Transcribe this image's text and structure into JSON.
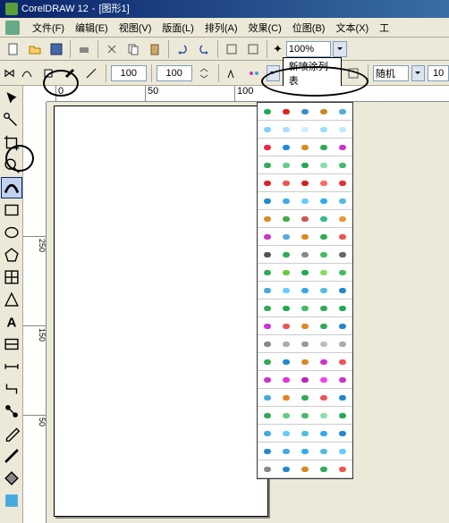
{
  "titlebar": {
    "appname": "CorelDRAW 12",
    "docname": "[图形1]"
  },
  "menu": {
    "file": "文件(F)",
    "edit": "编辑(E)",
    "view": "视图(V)",
    "layout": "版面(L)",
    "arrange": "排列(A)",
    "effects": "效果(C)",
    "bitmap": "位图(B)",
    "text": "文本(X)",
    "tools": "工"
  },
  "toolbar1": {
    "zoom": "100%"
  },
  "proptbar": {
    "size1": "100",
    "size2": "100",
    "spraylist_label": "新喷涂列表",
    "random": "随机",
    "val10": "10"
  },
  "ruler_h": {
    "t0": "0",
    "t50": "50",
    "t100": "100"
  },
  "ruler_v": {
    "t50": "50",
    "t150": "150",
    "t250": "250"
  },
  "spray_colors": [
    [
      "#2a5",
      "#d22",
      "#48c",
      "#c82",
      "#5ad"
    ],
    [
      "#8cf",
      "#adf",
      "#cef",
      "#9df",
      "#bef"
    ],
    [
      "#e24",
      "#28d",
      "#d82",
      "#3a5",
      "#c3c"
    ],
    [
      "#3a5",
      "#6c8",
      "#2a5",
      "#8da",
      "#4b6"
    ],
    [
      "#d22",
      "#e55",
      "#c22",
      "#f66",
      "#d33"
    ],
    [
      "#28c",
      "#4ad",
      "#6cf",
      "#3ae",
      "#5bd"
    ],
    [
      "#d82",
      "#4a4",
      "#c55",
      "#3b8",
      "#e93"
    ],
    [
      "#c3c",
      "#5ad",
      "#d82",
      "#3a5",
      "#e55"
    ],
    [
      "#555",
      "#3a5",
      "#888",
      "#4b6",
      "#666"
    ],
    [
      "#3a5",
      "#6c4",
      "#2a5",
      "#8d6",
      "#4b6"
    ],
    [
      "#4ad",
      "#6cf",
      "#3ae",
      "#5bd",
      "#28c"
    ],
    [
      "#3a5",
      "#2a5",
      "#4b6",
      "#3a5",
      "#2a5"
    ],
    [
      "#c3c",
      "#e55",
      "#d82",
      "#3a5",
      "#28c"
    ],
    [
      "#888",
      "#aab",
      "#999",
      "#bbc",
      "#aaa"
    ],
    [
      "#3a5",
      "#28c",
      "#d82",
      "#c3c",
      "#e55"
    ],
    [
      "#c3c",
      "#d3d",
      "#b2b",
      "#e4e",
      "#c3c"
    ],
    [
      "#4ad",
      "#d82",
      "#3a5",
      "#e55",
      "#28c"
    ],
    [
      "#3a5",
      "#6c8",
      "#4b6",
      "#8da",
      "#2a5"
    ],
    [
      "#4ad",
      "#6cf",
      "#5bd",
      "#3ae",
      "#28c"
    ],
    [
      "#28c",
      "#4ad",
      "#3ae",
      "#5bd",
      "#6cf"
    ],
    [
      "#888",
      "#28c",
      "#d82",
      "#3a5",
      "#e55"
    ]
  ]
}
